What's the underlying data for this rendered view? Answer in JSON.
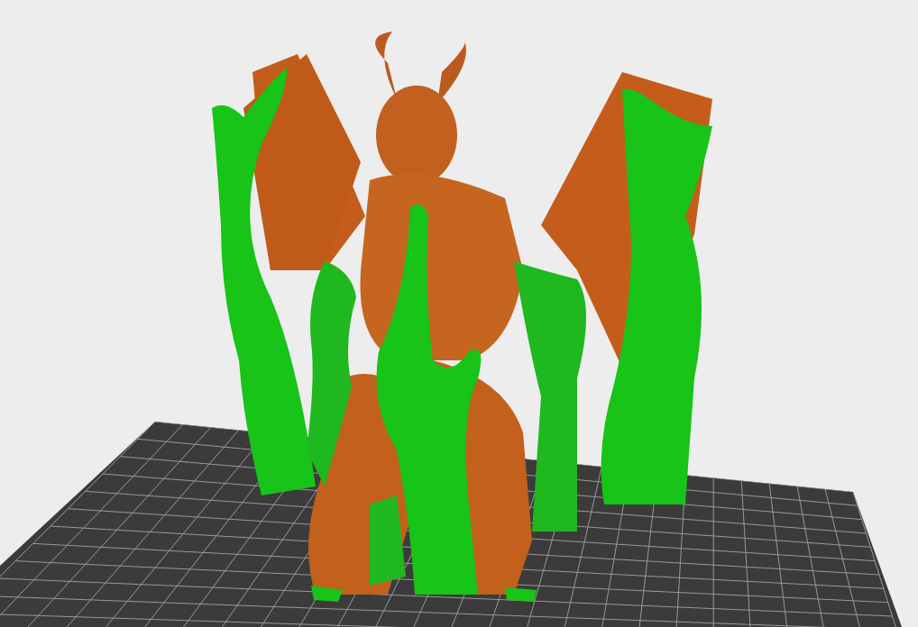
{
  "viewport": {
    "kind": "preview"
  }
}
